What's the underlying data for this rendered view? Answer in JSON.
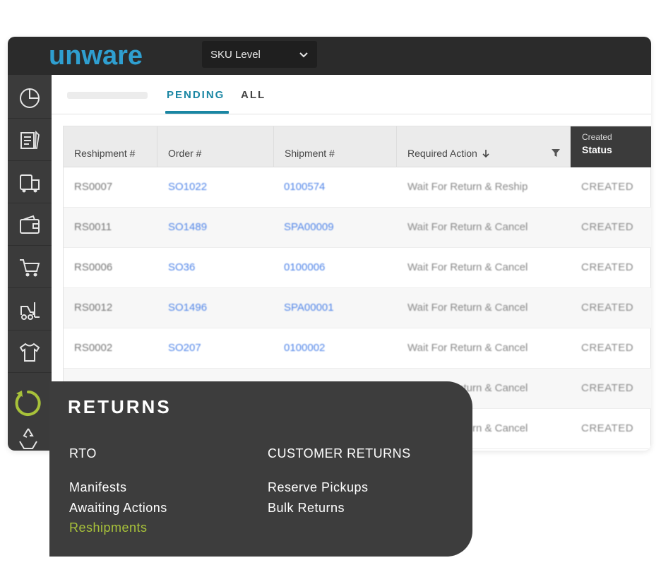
{
  "brand": {
    "logo_text": "unware",
    "accent": "#a8c23a",
    "logo_blue": "#2f9fd0"
  },
  "header": {
    "sku_select": {
      "value": "SKU Level"
    }
  },
  "sidebar": {
    "items": [
      {
        "icon": "pie-chart-icon"
      },
      {
        "icon": "document-edit-icon"
      },
      {
        "icon": "truck-icon"
      },
      {
        "icon": "wallet-icon"
      },
      {
        "icon": "cart-icon"
      },
      {
        "icon": "forklift-icon"
      },
      {
        "icon": "tshirt-icon"
      },
      {
        "icon": "returns-icon"
      },
      {
        "icon": "recycle-icon"
      }
    ]
  },
  "tabs": [
    {
      "label": "PENDING",
      "active": true
    },
    {
      "label": "ALL",
      "active": false
    }
  ],
  "table": {
    "columns": [
      "Reshipment #",
      "Order #",
      "Shipment #",
      "Required Action"
    ],
    "status_column": {
      "top": "Created",
      "label": "Status"
    },
    "rows": [
      {
        "reshipment": "RS0007",
        "order": "SO1022",
        "shipment": "0100574",
        "action": "Wait For Return & Reship",
        "status": "CREATED"
      },
      {
        "reshipment": "RS0011",
        "order": "SO1489",
        "shipment": "SPA00009",
        "action": "Wait For Return & Cancel",
        "status": "CREATED"
      },
      {
        "reshipment": "RS0006",
        "order": "SO36",
        "shipment": "0100006",
        "action": "Wait For Return & Cancel",
        "status": "CREATED"
      },
      {
        "reshipment": "RS0012",
        "order": "SO1496",
        "shipment": "SPA00001",
        "action": "Wait For Return & Cancel",
        "status": "CREATED"
      },
      {
        "reshipment": "RS0002",
        "order": "SO207",
        "shipment": "0100002",
        "action": "Wait For Return & Cancel",
        "status": "CREATED"
      },
      {
        "reshipment": "",
        "order": "",
        "shipment": "",
        "action": "Wait For Return & Cancel",
        "status": "CREATED"
      },
      {
        "reshipment": "",
        "order": "",
        "shipment": "",
        "action": "Wait For Return & Cancel",
        "status": "CREATED"
      }
    ]
  },
  "flyout": {
    "title": "RETURNS",
    "rto": {
      "heading": "RTO",
      "links": [
        "Manifests",
        "Awaiting Actions",
        "Reshipments"
      ]
    },
    "customer_returns": {
      "heading": "CUSTOMER RETURNS",
      "links": [
        "Reserve Pickups",
        "Bulk Returns"
      ]
    },
    "active_link": "Reshipments"
  }
}
